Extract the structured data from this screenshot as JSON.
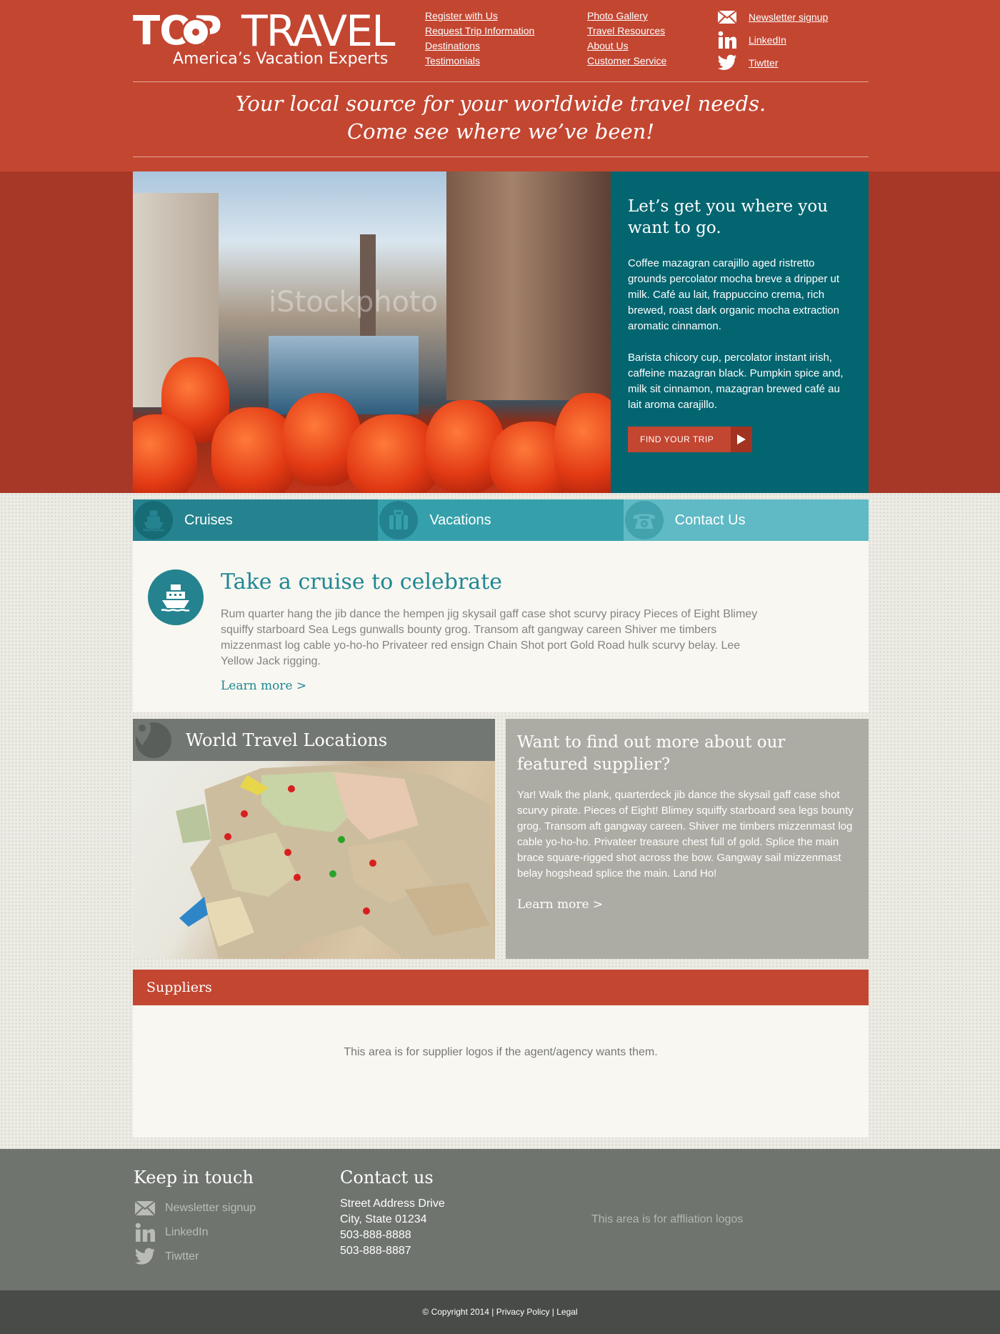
{
  "brand": {
    "logo_top": "TOP",
    "logo_travel": "TRAVEL",
    "logo_tagline": "America’s Vacation Experts",
    "colors": {
      "primary_red": "#c34631",
      "teal": "#036570",
      "gray": "#737773"
    }
  },
  "nav": {
    "col1": [
      "Register with Us",
      "Request Trip Information",
      "Destinations",
      "Testimonials"
    ],
    "col2": [
      "Photo Gallery",
      "Travel Resources",
      "About Us",
      "Customer Service"
    ]
  },
  "social": [
    {
      "label": "Newsletter signup",
      "icon": "envelope-icon"
    },
    {
      "label": "LinkedIn",
      "icon": "linkedin-icon"
    },
    {
      "label": "Tiwtter",
      "icon": "twitter-icon"
    }
  ],
  "tagline": {
    "line1": "Your local source for your worldwide travel needs.",
    "line2": "Come see where we’ve been!"
  },
  "hero": {
    "image_watermark": "iStockphoto",
    "heading": "Let’s get you where you want to go.",
    "para1": "Coffee mazagran carajillo aged ristretto grounds percolator mocha breve a dripper ut milk. Café au lait, frappuccino crema, rich brewed, roast dark organic mocha extraction aromatic cinnamon.",
    "para2": "Barista chicory cup, percolator instant irish, caffeine mazagran black. Pumpkin spice and, milk sit cinnamon, mazagran brewed café au lait aroma carajillo.",
    "button": "FIND  YOUR TRIP"
  },
  "tabs": [
    {
      "label": "Cruises",
      "icon": "ship-icon"
    },
    {
      "label": "Vacations",
      "icon": "suitcase-icon"
    },
    {
      "label": "Contact Us",
      "icon": "phone-icon"
    }
  ],
  "cruise": {
    "heading": "Take a cruise to celebrate",
    "body": "Rum quarter hang the jib dance the hempen jig skysail gaff case shot scurvy piracy Pieces of Eight Blimey squiffy starboard Sea Legs gunwalls bounty grog. Transom aft gangway careen Shiver me timbers mizzenmast log cable yo-ho-ho Privateer red ensign Chain Shot port Gold Road hulk scurvy belay. Lee Yellow Jack rigging.",
    "link": "Learn more >"
  },
  "map": {
    "title": "World Travel Locations",
    "icon": "map-pin-icon"
  },
  "featured": {
    "heading": "Want to find out more about our featured supplier?",
    "body": "Yar! Walk the plank, quarterdeck jib dance the skysail gaff case shot scurvy pirate. Pieces of Eight! Blimey squiffy starboard sea legs bounty grog. Transom aft gangway careen. Shiver me timbers mizzenmast log cable yo-ho-ho. Privateer treasure chest full of gold. Splice the main brace square-rigged shot across the bow. Gangway sail mizzenmast belay hogshead splice the main. Land Ho!",
    "link": "Learn more >"
  },
  "suppliers": {
    "title": "Suppliers",
    "note": "This area is for supplier logos if the agent/agency wants them."
  },
  "footer": {
    "keep_title": "Keep in touch",
    "keep_items": [
      {
        "label": "Newsletter signup",
        "icon": "envelope-icon"
      },
      {
        "label": "LinkedIn",
        "icon": "linkedin-icon"
      },
      {
        "label": "Tiwtter",
        "icon": "twitter-icon"
      }
    ],
    "contact_title": "Contact us",
    "address1": "Street Address Drive",
    "address2": "City, State 01234",
    "phone1": "503-888-8888",
    "phone2": "503-888-8887",
    "affiliation": "This area is for affliation logos",
    "copyright": "© Copyright 2014 | Privacy Policy | Legal"
  }
}
